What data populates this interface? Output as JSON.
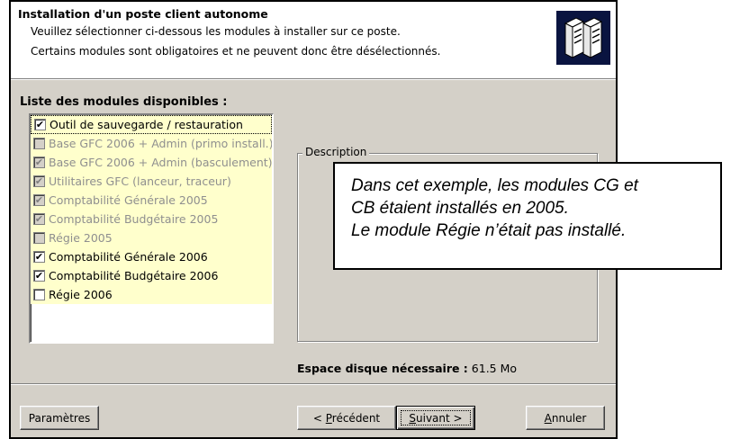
{
  "header": {
    "title": "Installation d'un poste client autonome",
    "line1": "Veuillez sélectionner ci-dessous les modules à installer sur ce poste.",
    "line2": "Certains modules sont obligatoires et ne peuvent donc être désélectionnés.",
    "logo_icon": "server-icon"
  },
  "modules": {
    "label": "Liste des modules disponibles :",
    "items": [
      {
        "label": "Outil de sauvegarde / restauration",
        "checked": true,
        "enabled": true
      },
      {
        "label": "Base GFC 2006 + Admin (primo install.)",
        "checked": false,
        "enabled": false
      },
      {
        "label": "Base GFC 2006 + Admin (basculement)",
        "checked": true,
        "enabled": false
      },
      {
        "label": "Utilitaires GFC (lanceur, traceur)",
        "checked": true,
        "enabled": false
      },
      {
        "label": "Comptabilité Générale 2005",
        "checked": true,
        "enabled": false
      },
      {
        "label": "Comptabilité Budgétaire 2005",
        "checked": true,
        "enabled": false
      },
      {
        "label": "Régie 2005",
        "checked": false,
        "enabled": false
      },
      {
        "label": "Comptabilité Générale 2006",
        "checked": true,
        "enabled": true
      },
      {
        "label": "Comptabilité Budgétaire 2006",
        "checked": true,
        "enabled": true
      },
      {
        "label": "Régie 2006",
        "checked": false,
        "enabled": true
      }
    ]
  },
  "description": {
    "label": "Description"
  },
  "disk": {
    "label": "Espace disque nécessaire :",
    "value": "61.5 Mo"
  },
  "buttons": {
    "params": "Paramètres",
    "prev_prefix": "< ",
    "prev_u": "P",
    "prev_rest": "récédent",
    "next_u": "S",
    "next_rest": "uivant >",
    "cancel_u": "A",
    "cancel_rest": "nnuler"
  },
  "callout": {
    "line1": "Dans cet exemple, les modules CG et",
    "line2": "CB étaient installés en 2005.",
    "line3": "Le module Régie n’était pas installé."
  },
  "colors": {
    "list_bg": "#ffffcc",
    "dialog_bg": "#d4d0c8",
    "logo_bg": "#0a1440"
  }
}
